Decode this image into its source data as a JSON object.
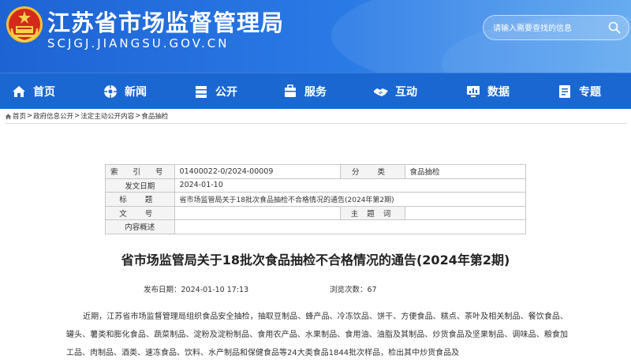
{
  "header": {
    "site_title": "江苏省市场监督管理局",
    "site_domain": "SCJGJ.JIANGSU.GOV.CN",
    "search_placeholder": "请输入需要查找的信息",
    "colors": {
      "header_bg": "#1e63d4",
      "nav_bg": "#1a67d2"
    }
  },
  "nav": {
    "items": [
      {
        "label": "首页",
        "icon": "home-icon"
      },
      {
        "label": "新闻",
        "icon": "news-icon"
      },
      {
        "label": "公开",
        "icon": "open-info-icon"
      },
      {
        "label": "服务",
        "icon": "service-icon"
      },
      {
        "label": "互动",
        "icon": "handshake-icon"
      },
      {
        "label": "数据",
        "icon": "data-icon"
      },
      {
        "label": "专题",
        "icon": "topic-icon"
      }
    ]
  },
  "breadcrumb": {
    "items": [
      "首页",
      "政府信息公开",
      "法定主动公开内容",
      "食品抽检"
    ],
    "separator": ">"
  },
  "meta": {
    "index_label": "索 引 号",
    "index_value": "01400022-0/2024-00009",
    "category_label": "分 类",
    "category_value": "食品抽检",
    "date_label": "发文日期",
    "date_value": "2024-01-10",
    "title_label": "标 题",
    "title_value": "省市场监管局关于18批次食品抽检不合格情况的通告(2024年第2期)",
    "docno_label": "文 号",
    "docno_value": "",
    "subject_label": "主 题 词",
    "subject_value": "",
    "summary_label": "内容概述",
    "summary_value": ""
  },
  "article": {
    "title": "省市场监管局关于18批次食品抽检不合格情况的通告(2024年第2期)",
    "published_label": "发布日期：",
    "published_value": "2024-01-10 17:13",
    "views_label": "浏览次数：",
    "views_value": "67",
    "body": "近期，江苏省市场监督管理局组织食品安全抽检，抽取豆制品、蜂产品、冷冻饮品、饼干、方便食品、糕点、茶叶及相关制品、餐饮食品、罐头、薯类和膨化食品、蔬菜制品、淀粉及淀粉制品、食用农产品、水果制品、食用油、油脂及其制品、炒货食品及坚果制品、调味品、粮食加工品、肉制品、酒类、速冻食品、饮料、水产制品和保健食品等24大类食品1844批次样品，检出其中炒货食品及"
  }
}
